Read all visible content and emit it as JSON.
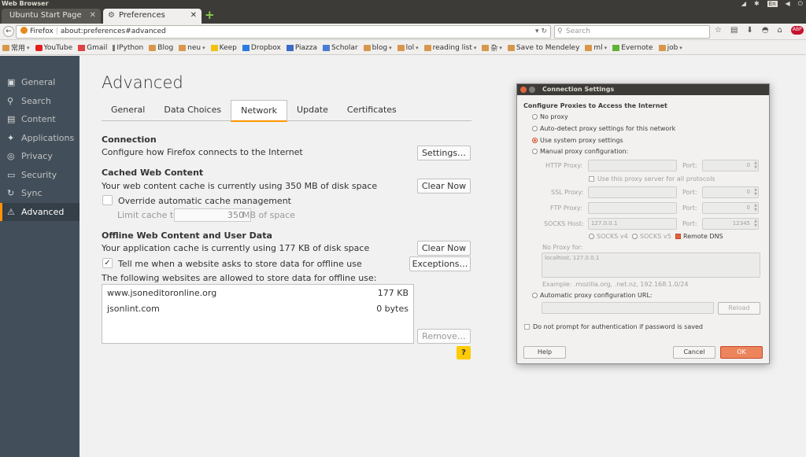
{
  "system": {
    "app_title": "Web Browser",
    "lang": "En"
  },
  "tabs": [
    {
      "label": "Ubuntu Start Page"
    },
    {
      "label": "Preferences"
    }
  ],
  "nav": {
    "site_label": "Firefox",
    "url": "about:preferences#advanced",
    "search_placeholder": "Search"
  },
  "bookmarks": [
    {
      "label": "常用",
      "icon": "folder",
      "menu": true
    },
    {
      "label": "YouTube",
      "icon": "yt"
    },
    {
      "label": "Gmail",
      "icon": "gm"
    },
    {
      "label": "IPython",
      "icon": "ip"
    },
    {
      "label": "Blog",
      "icon": "folder"
    },
    {
      "label": "neu",
      "icon": "folder",
      "menu": true
    },
    {
      "label": "Keep",
      "icon": "kp"
    },
    {
      "label": "Dropbox",
      "icon": "db"
    },
    {
      "label": "Piazza",
      "icon": "pz"
    },
    {
      "label": "Scholar",
      "icon": "sc"
    },
    {
      "label": "blog",
      "icon": "folder",
      "menu": true
    },
    {
      "label": "lol",
      "icon": "folder",
      "menu": true
    },
    {
      "label": "reading list",
      "icon": "folder",
      "menu": true
    },
    {
      "label": "杂",
      "icon": "folder",
      "menu": true
    },
    {
      "label": "Save to Mendeley",
      "icon": "folder"
    },
    {
      "label": "ml",
      "icon": "folder",
      "menu": true
    },
    {
      "label": "Evernote",
      "icon": "ev"
    },
    {
      "label": "job",
      "icon": "folder",
      "menu": true
    }
  ],
  "sidebar": {
    "items": [
      {
        "label": "General",
        "icon": "general-icon"
      },
      {
        "label": "Search",
        "icon": "search-icon"
      },
      {
        "label": "Content",
        "icon": "content-icon"
      },
      {
        "label": "Applications",
        "icon": "applications-icon"
      },
      {
        "label": "Privacy",
        "icon": "privacy-icon"
      },
      {
        "label": "Security",
        "icon": "security-icon"
      },
      {
        "label": "Sync",
        "icon": "sync-icon"
      },
      {
        "label": "Advanced",
        "icon": "advanced-icon"
      }
    ]
  },
  "main": {
    "title": "Advanced",
    "tabs": [
      "General",
      "Data Choices",
      "Network",
      "Update",
      "Certificates"
    ],
    "connection": {
      "title": "Connection",
      "desc": "Configure how Firefox connects to the Internet",
      "settings_btn": "Settings…"
    },
    "cache": {
      "title": "Cached Web Content",
      "desc": "Your web content cache is currently using 350 MB of disk space",
      "clear_btn": "Clear Now",
      "override_label": "Override automatic cache management",
      "limit_label": "Limit cache to",
      "limit_value": "350",
      "limit_unit": "MB of space"
    },
    "offline": {
      "title": "Offline Web Content and User Data",
      "desc": "Your application cache is currently using 177 KB of disk space",
      "clear_btn": "Clear Now",
      "tell_label": "Tell me when a website asks to store data for offline use",
      "exceptions_btn": "Exceptions…",
      "list_label": "The following websites are allowed to store data for offline use:",
      "sites": [
        {
          "site": "www.jsoneditoronline.org",
          "size": "177 KB"
        },
        {
          "site": "jsonlint.com",
          "size": "0 bytes"
        }
      ],
      "remove_btn": "Remove…"
    },
    "help": "?"
  },
  "dialog": {
    "title": "Connection Settings",
    "heading": "Configure Proxies to Access the Internet",
    "options": {
      "none": "No proxy",
      "auto_detect": "Auto-detect proxy settings for this network",
      "system": "Use system proxy settings",
      "manual": "Manual proxy configuration:"
    },
    "http_label": "HTTP Proxy:",
    "same_proxy": "Use this proxy server for all protocols",
    "ssl_label": "SSL Proxy:",
    "ftp_label": "FTP Proxy:",
    "socks_label": "SOCKS Host:",
    "socks_host": "127.0.0.1",
    "port_label": "Port:",
    "http_port": "0",
    "ssl_port": "0",
    "ftp_port": "0",
    "socks_port": "12345",
    "socks_v4": "SOCKS v4",
    "socks_v5": "SOCKS v5",
    "remote_dns": "Remote DNS",
    "no_proxy_label": "No Proxy for:",
    "no_proxy_value": "localhost, 127.0.0.1",
    "example": "Example: .mozilla.org, .net.nz, 192.168.1.0/24",
    "auto_url_label": "Automatic proxy configuration URL:",
    "reload_btn": "Reload",
    "no_prompt": "Do not prompt for authentication if password is saved",
    "help_btn": "Help",
    "cancel_btn": "Cancel",
    "ok_btn": "OK"
  }
}
